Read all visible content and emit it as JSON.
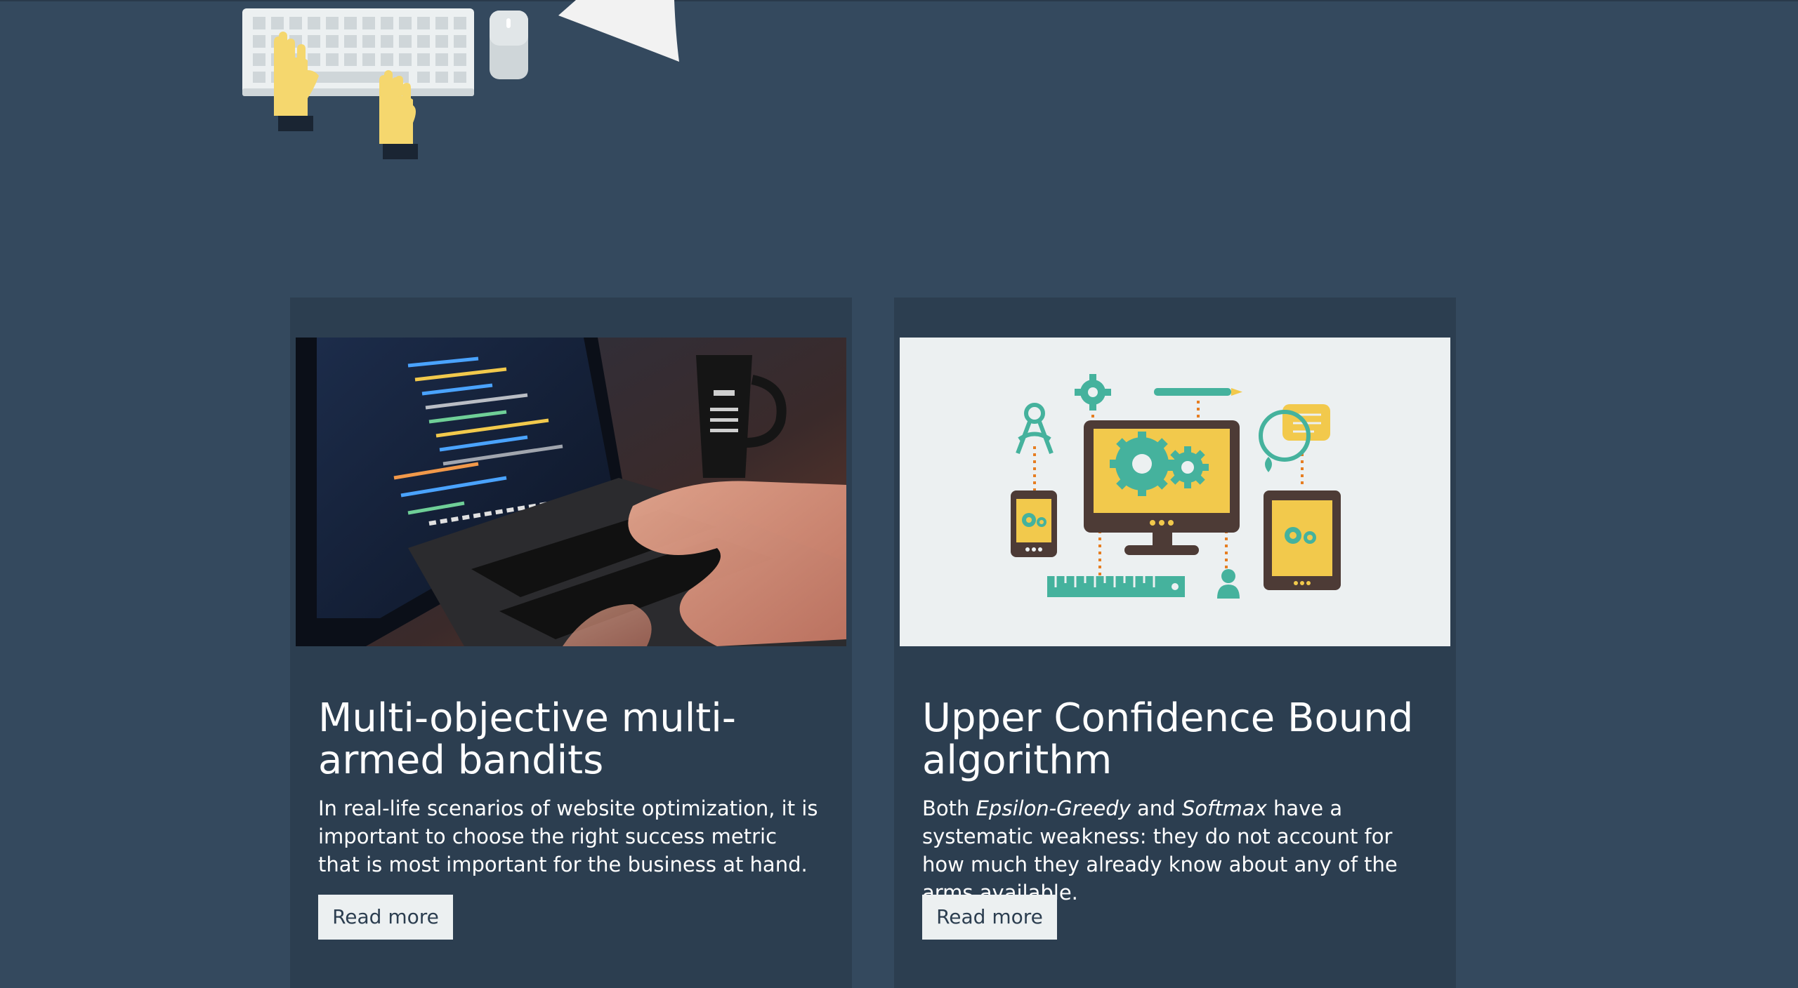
{
  "hero": {
    "illustration_icons": [
      "keyboard-icon",
      "hand-icon",
      "mouse-icon",
      "paper-icon"
    ],
    "colors": {
      "background": "#34495e",
      "hand": "#f5d76e",
      "cuff": "#1a2533",
      "keyboard": "#ecf0f1"
    }
  },
  "cards": [
    {
      "title": "Multi-objective multi-armed bandits",
      "excerpt": "In real-life scenarios of website optimization, it is important to choose the right success metric that is most important for the business at hand.",
      "button_label": "Read more",
      "image_icon": "laptop-code-photo"
    },
    {
      "title": "Upper Confidence Bound algorithm",
      "excerpt_parts": {
        "p1": "Both ",
        "em1": "Epsilon-Greedy",
        "p2": " and ",
        "em2": "Softmax",
        "p3": " have a systematic weakness: they do not account for how much they already know about any of the arms available."
      },
      "button_label": "Read more",
      "image_icon": "devices-gears-illustration"
    }
  ],
  "colors": {
    "card_bg": "#2c3e50",
    "button_bg": "#ecf0f1",
    "button_text": "#2c3e50",
    "text": "#ffffff",
    "accent_green": "#45b29d",
    "accent_yellow": "#f2c94c",
    "accent_orange": "#e67e22"
  }
}
